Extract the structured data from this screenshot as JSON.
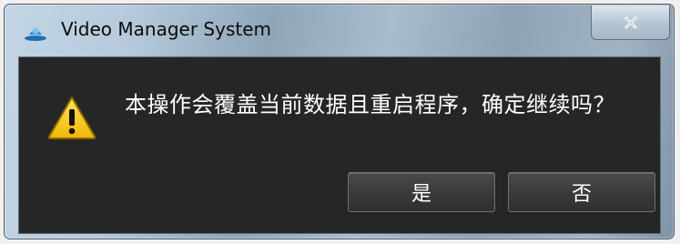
{
  "window": {
    "title": "Video Manager System",
    "icon": "app-logo-icon",
    "close_icon": "close-icon"
  },
  "dialog": {
    "icon": "warning-icon",
    "message": "本操作会覆盖当前数据且重启程序，确定继续吗？",
    "buttons": {
      "yes_label": "是",
      "no_label": "否"
    }
  },
  "colors": {
    "content_background": "#262626",
    "warning_yellow": "#f6c40f",
    "text": "#ffffff"
  }
}
